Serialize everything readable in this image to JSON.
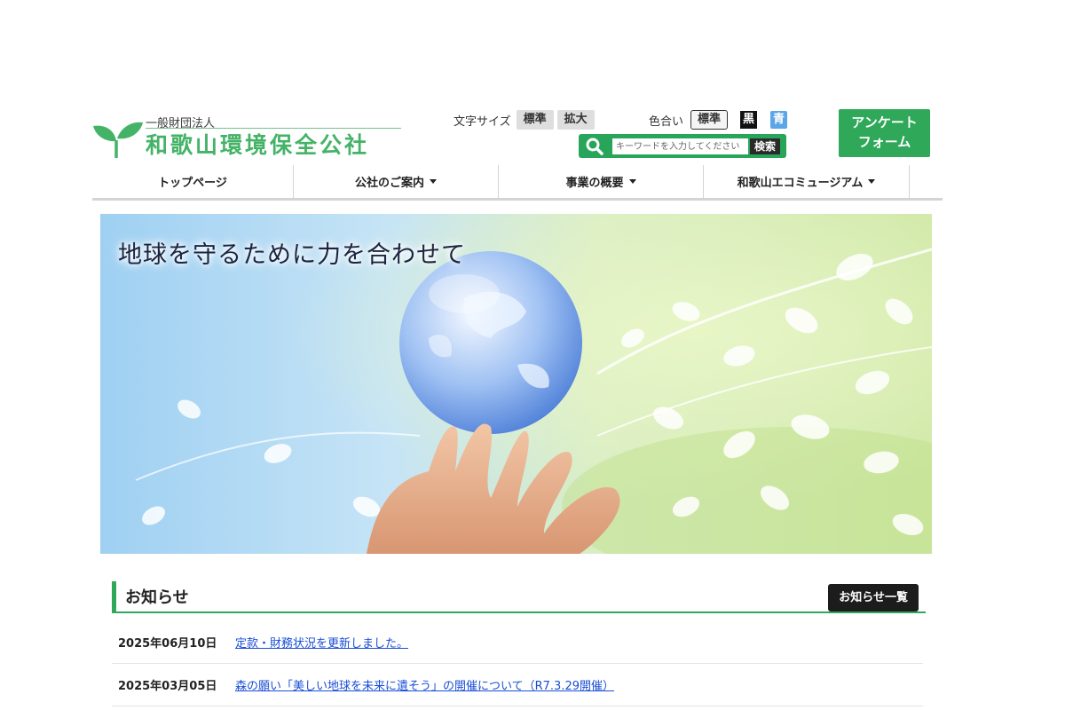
{
  "header": {
    "org_type": "一般財団法人",
    "org_name": "和歌山環境保全公社",
    "font_size": {
      "label": "文字サイズ",
      "standard": "標準",
      "large": "拡大"
    },
    "color_scheme": {
      "label": "色合い",
      "standard": "標準",
      "black": "黒",
      "blue": "青"
    },
    "search": {
      "placeholder": "キーワードを入力してください",
      "button": "検索"
    },
    "survey_button": {
      "line1": "アンケート",
      "line2": "フォーム"
    }
  },
  "nav": {
    "items": [
      {
        "label": "トップページ",
        "dropdown": false
      },
      {
        "label": "公社のご案内",
        "dropdown": true
      },
      {
        "label": "事業の概要",
        "dropdown": true
      },
      {
        "label": "和歌山エコミュージアム",
        "dropdown": true
      }
    ]
  },
  "hero": {
    "slogan": "地球を守るために力を合わせて"
  },
  "news": {
    "title": "お知らせ",
    "all_button": "お知らせ一覧",
    "items": [
      {
        "date": "2025年06月10日",
        "text": "定款・財務状況を更新しました。"
      },
      {
        "date": "2025年03月05日",
        "text": "森の願い「美しい地球を未来に遺そう」の開催について（R7.3.29開催）"
      }
    ]
  },
  "colors": {
    "brand_green": "#2fa85a",
    "logo_green": "#44b367",
    "link_blue": "#1a4ed6"
  }
}
